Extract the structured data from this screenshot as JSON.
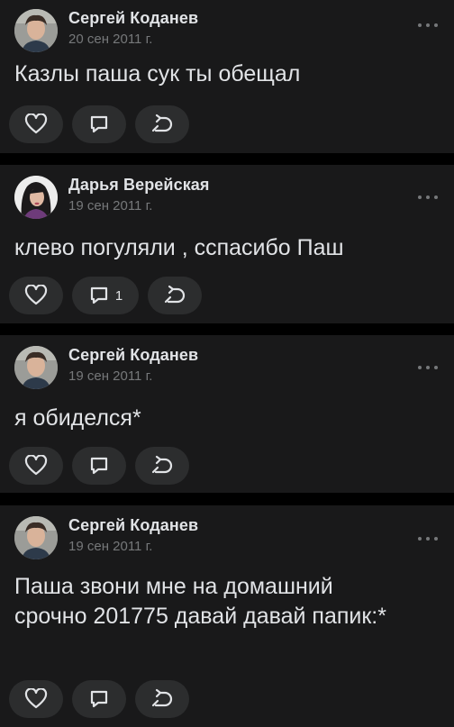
{
  "colors": {
    "background": "#000000",
    "card": "#19191a",
    "text_primary": "#e1e3e6",
    "text_secondary": "#76787a",
    "button_bg": "#2c2d2e"
  },
  "icons": {
    "more": "more-horizontal-icon",
    "like": "heart-outline-icon",
    "comment": "comment-outline-icon",
    "share": "share-outline-icon"
  },
  "posts": [
    {
      "author": "Сергей Коданев",
      "date": "20 сен 2011 г.",
      "text": "Казлы паша сук ты обещал",
      "comments_count": ""
    },
    {
      "author": "Дарья Верейская",
      "date": "19 сен 2011 г.",
      "text": "клево погуляли , сспасибо Паш",
      "comments_count": "1"
    },
    {
      "author": "Сергей Коданев",
      "date": "19 сен 2011 г.",
      "text": "я обиделся*",
      "comments_count": ""
    },
    {
      "author": "Сергей Коданев",
      "date": "19 сен 2011 г.",
      "text": "Паша звони мне на домашний срочно 201775 давай давай папик:*",
      "comments_count": ""
    }
  ]
}
